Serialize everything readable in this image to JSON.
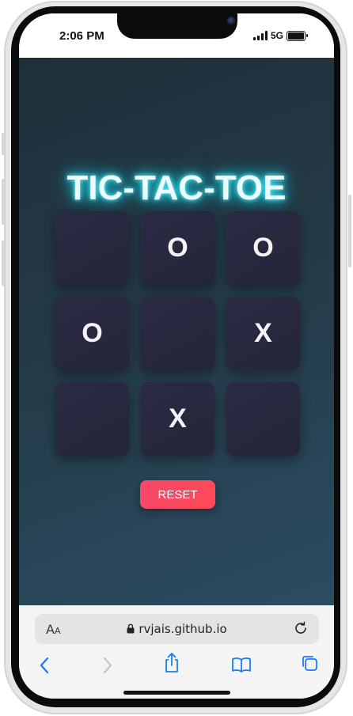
{
  "status_bar": {
    "time": "2:06 PM",
    "network": "5G"
  },
  "game": {
    "title": "TIC-TAC-TOE",
    "cells": [
      "",
      "O",
      "O",
      "O",
      "",
      "X",
      "",
      "X",
      ""
    ],
    "reset_label": "RESET",
    "colors": {
      "title_glow": "#20e0f0",
      "reset_button": "#f64868",
      "cell_background": "#2b2a44"
    }
  },
  "browser": {
    "text_size_label": "AA",
    "url": "rvjais.github.io",
    "icons": [
      "lock-icon",
      "reload-icon",
      "back-icon",
      "forward-icon",
      "share-icon",
      "bookmarks-icon",
      "tabs-icon"
    ],
    "accent_color": "#1a7cf5"
  }
}
